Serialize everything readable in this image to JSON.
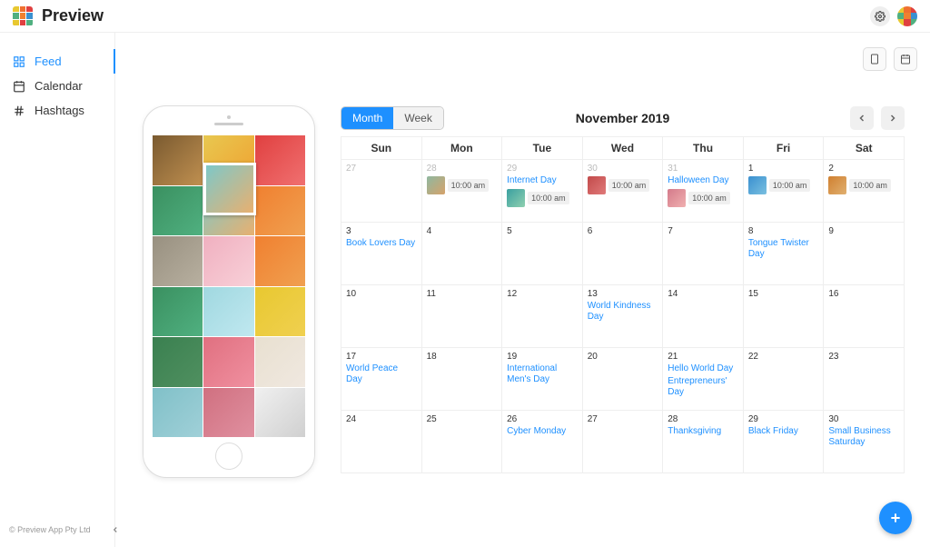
{
  "app": {
    "title": "Preview",
    "footer": "© Preview App Pty Ltd"
  },
  "sidebar": {
    "items": [
      {
        "label": "Feed",
        "icon": "grid"
      },
      {
        "label": "Calendar",
        "icon": "calendar"
      },
      {
        "label": "Hashtags",
        "icon": "hash"
      }
    ]
  },
  "calendar": {
    "view": {
      "month": "Month",
      "week": "Week"
    },
    "title": "November 2019",
    "day_headers": [
      "Sun",
      "Mon",
      "Tue",
      "Wed",
      "Thu",
      "Fri",
      "Sat"
    ],
    "weeks": [
      [
        {
          "num": "27",
          "muted": true
        },
        {
          "num": "28",
          "muted": true,
          "posts": [
            {
              "time": "10:00 am",
              "c1": "#8fb8a0",
              "c2": "#d6a26a"
            }
          ]
        },
        {
          "num": "29",
          "muted": true,
          "events": [
            "Internet Day"
          ],
          "posts": [
            {
              "time": "10:00 am",
              "c1": "#3aa0a0",
              "c2": "#8fd0b0"
            }
          ]
        },
        {
          "num": "30",
          "muted": true,
          "posts": [
            {
              "time": "10:00 am",
              "c1": "#c24a4a",
              "c2": "#e07a7a"
            }
          ]
        },
        {
          "num": "31",
          "muted": true,
          "events": [
            "Halloween Day"
          ],
          "posts": [
            {
              "time": "10:00 am",
              "c1": "#d47a8a",
              "c2": "#f0b0b0"
            }
          ]
        },
        {
          "num": "1",
          "posts": [
            {
              "time": "10:00 am",
              "c1": "#3a90d0",
              "c2": "#7ac0e0"
            }
          ]
        },
        {
          "num": "2",
          "posts": [
            {
              "time": "10:00 am",
              "c1": "#d08030",
              "c2": "#e0b070"
            }
          ]
        }
      ],
      [
        {
          "num": "3",
          "events": [
            "Book Lovers Day"
          ]
        },
        {
          "num": "4"
        },
        {
          "num": "5"
        },
        {
          "num": "6"
        },
        {
          "num": "7"
        },
        {
          "num": "8",
          "events": [
            "Tongue Twister Day"
          ]
        },
        {
          "num": "9"
        }
      ],
      [
        {
          "num": "10"
        },
        {
          "num": "11"
        },
        {
          "num": "12"
        },
        {
          "num": "13",
          "events": [
            "World Kindness Day"
          ]
        },
        {
          "num": "14"
        },
        {
          "num": "15"
        },
        {
          "num": "16"
        }
      ],
      [
        {
          "num": "17",
          "events": [
            "World Peace Day"
          ]
        },
        {
          "num": "18"
        },
        {
          "num": "19",
          "events": [
            "International Men's Day"
          ]
        },
        {
          "num": "20"
        },
        {
          "num": "21",
          "events": [
            "Hello World Day",
            "Entrepreneurs' Day"
          ]
        },
        {
          "num": "22"
        },
        {
          "num": "23"
        }
      ],
      [
        {
          "num": "24"
        },
        {
          "num": "25"
        },
        {
          "num": "26",
          "events": [
            "Cyber Monday"
          ]
        },
        {
          "num": "27"
        },
        {
          "num": "28",
          "events": [
            "Thanksgiving"
          ]
        },
        {
          "num": "29",
          "events": [
            "Black Friday"
          ]
        },
        {
          "num": "30",
          "events": [
            "Small Business Saturday"
          ]
        }
      ]
    ]
  },
  "phone_grid_colors": [
    [
      "#7a5a30",
      "#c09050"
    ],
    [
      "#e8c850",
      "#f0a030"
    ],
    [
      "#e04040",
      "#f07070"
    ],
    [
      "#3a9060",
      "#50b080"
    ],
    [
      "#7ec8c8",
      "#e8b070"
    ],
    [
      "#f08030",
      "#f0a050"
    ],
    [
      "#989080",
      "#b8b0a0"
    ],
    [
      "#f0b0c0",
      "#f8d0d8"
    ],
    [
      "#f08030",
      "#f0a050"
    ],
    [
      "#3a9060",
      "#50b080"
    ],
    [
      "#a0d8e0",
      "#c0e8f0"
    ],
    [
      "#e8c830",
      "#f0d050"
    ],
    [
      "#3a8050",
      "#509060"
    ],
    [
      "#e07080",
      "#f090a0"
    ],
    [
      "#e8e0d0",
      "#f0e8e0"
    ],
    [
      "#80c0c8",
      "#a0d0d8"
    ],
    [
      "#d07080",
      "#e090a0"
    ],
    [
      "#f0f0f0",
      "#d0d0d0"
    ]
  ],
  "logo_colors": [
    "#e8c830",
    "#f07030",
    "#e04040",
    "#50b080",
    "#f08030",
    "#3a90d0",
    "#e8c830",
    "#e04040",
    "#50b080"
  ]
}
